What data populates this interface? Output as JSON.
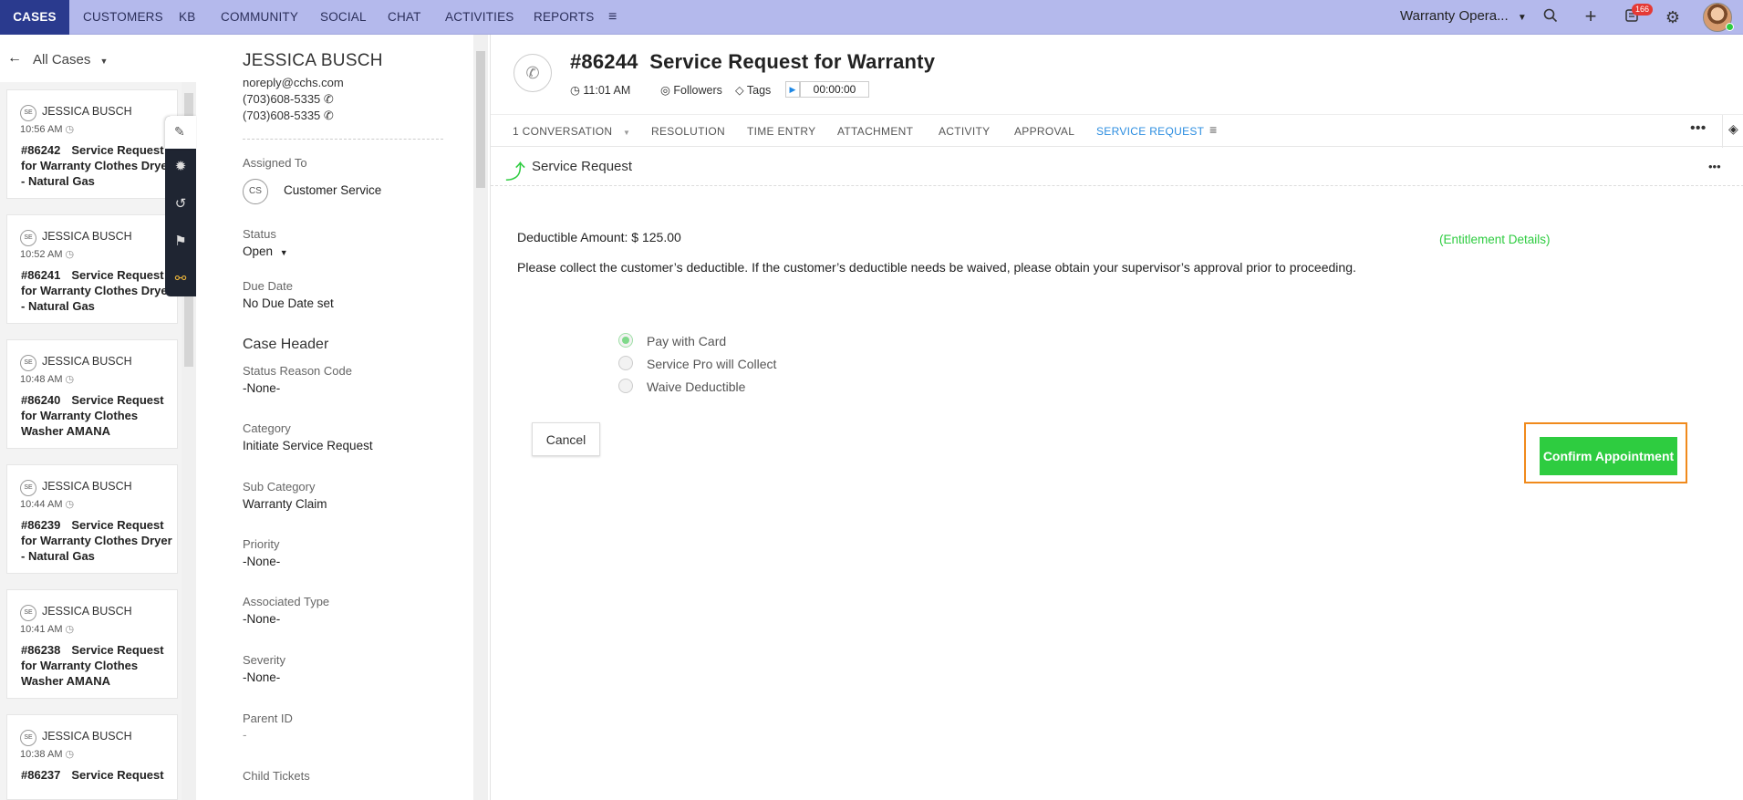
{
  "topnav": {
    "tabs": [
      "CASES",
      "CUSTOMERS",
      "KB",
      "COMMUNITY",
      "SOCIAL",
      "CHAT",
      "ACTIVITIES",
      "REPORTS"
    ],
    "department": "Warranty Opera...",
    "notification_count": "166"
  },
  "left": {
    "view": "All Cases",
    "cases": [
      {
        "initials": "SE",
        "name": "JESSICA BUSCH",
        "time": "10:56 AM",
        "number": "#86242",
        "title": "Service Request for Warranty Clothes Dryer - Natural Gas"
      },
      {
        "initials": "SE",
        "name": "JESSICA BUSCH",
        "time": "10:52 AM",
        "number": "#86241",
        "title": "Service Request for Warranty Clothes Dryer - Natural Gas"
      },
      {
        "initials": "SE",
        "name": "JESSICA BUSCH",
        "time": "10:48 AM",
        "number": "#86240",
        "title": "Service Request for Warranty Clothes Washer AMANA"
      },
      {
        "initials": "SE",
        "name": "JESSICA BUSCH",
        "time": "10:44 AM",
        "number": "#86239",
        "title": "Service Request for Warranty Clothes Dryer - Natural Gas"
      },
      {
        "initials": "SE",
        "name": "JESSICA BUSCH",
        "time": "10:41 AM",
        "number": "#86238",
        "title": "Service Request for Warranty Clothes Washer AMANA"
      },
      {
        "initials": "SE",
        "name": "JESSICA BUSCH",
        "time": "10:38 AM",
        "number": "#86237",
        "title": "Service Request"
      }
    ]
  },
  "details": {
    "name": "JESSICA BUSCH",
    "email": "noreply@cchs.com",
    "phone1": "(703)608-5335",
    "phone2": "(703)608-5335",
    "assigned_label": "Assigned To",
    "assigned_initials": "CS",
    "assigned_value": "Customer Service",
    "status_label": "Status",
    "status_value": "Open",
    "due_label": "Due Date",
    "due_value": "No Due Date set",
    "section": "Case Header",
    "reason_label": "Status Reason Code",
    "reason_value": "-None-",
    "category_label": "Category",
    "category_value": "Initiate Service Request",
    "subcat_label": "Sub Category",
    "subcat_value": "Warranty Claim",
    "priority_label": "Priority",
    "priority_value": "-None-",
    "assoc_label": "Associated Type",
    "assoc_value": "-None-",
    "severity_label": "Severity",
    "severity_value": "-None-",
    "parent_label": "Parent ID",
    "parent_value": "-",
    "child_label": "Child Tickets"
  },
  "ticket": {
    "number": "#86244",
    "title": "Service Request for Warranty",
    "time": "11:01 AM",
    "followers": "Followers",
    "tags": "Tags",
    "timer": "00:00:00",
    "tabs": [
      "1 CONVERSATION",
      "RESOLUTION",
      "TIME ENTRY",
      "ATTACHMENT",
      "ACTIVITY",
      "APPROVAL",
      "SERVICE REQUEST"
    ],
    "active_tab": "SERVICE REQUEST"
  },
  "service_request": {
    "heading": "Service Request",
    "deductible": "Deductible Amount: $ 125.00",
    "entitlement_link": "(Entitlement Details)",
    "instruction": "Please collect the customer’s deductible. If the customer’s deductible needs be waived, please obtain your supervisor’s approval prior to proceeding.",
    "options": [
      "Pay with Card",
      "Service Pro will Collect",
      "Waive Deductible"
    ],
    "selected_option": "Pay with Card",
    "cancel_label": "Cancel",
    "confirm_label": "Confirm Appointment"
  },
  "colors": {
    "nav_bg": "#b4b9ec",
    "nav_active": "#2a3a8e",
    "accent_green": "#2ecc40",
    "active_tab_blue": "#2b8de0",
    "highlight_orange": "#f08a1c"
  }
}
